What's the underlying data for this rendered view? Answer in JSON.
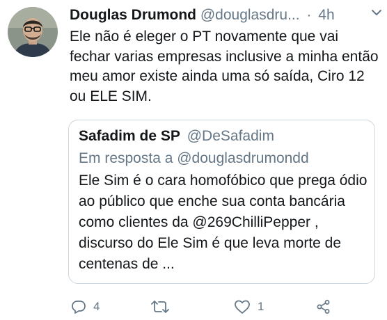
{
  "tweet": {
    "author_name": "Douglas Drumond",
    "author_handle": "@douglasdru...",
    "separator": "·",
    "time": "4h",
    "text": "Ele não é eleger o PT novamente que  vai fechar varias empresas inclusive a minha então meu amor existe ainda uma só saída, Ciro 12 ou ELE SIM."
  },
  "quote": {
    "author_name": "Safadim de SP",
    "author_handle": "@DeSafadim",
    "reply_to": "Em resposta a @douglasdrumondd",
    "text": "Ele Sim é o cara homofóbico que prega ódio ao  público que enche sua conta bancária como clientes da @269ChilliPepper  , discurso do Ele Sim é que leva morte de centenas de ..."
  },
  "actions": {
    "reply_count": "4",
    "retweet_count": "",
    "like_count": "1"
  },
  "icons": {
    "reply": "reply-icon",
    "retweet": "retweet-icon",
    "like": "heart-icon",
    "share": "share-icon",
    "more": "chevron-down-icon"
  },
  "colors": {
    "text": "#14171a",
    "secondary": "#657786",
    "border": "#ccd6dd"
  }
}
